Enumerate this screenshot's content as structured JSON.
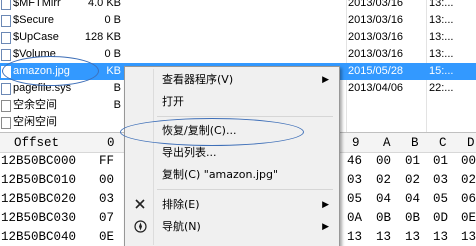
{
  "file_list": {
    "rows": [
      {
        "name": "$MFTMirr",
        "size": "4.0 KB",
        "date": "2013/03/16",
        "time": "13:...",
        "icon": "file-icon"
      },
      {
        "name": "$Secure",
        "size": "0 B",
        "date": "2013/03/16",
        "time": "13:...",
        "icon": "file-icon"
      },
      {
        "name": "$UpCase",
        "size": "128 KB",
        "date": "2013/03/16",
        "time": "13:...",
        "icon": "file-icon"
      },
      {
        "name": "$Volume",
        "size": "0 B",
        "date": "2013/03/16",
        "time": "13:...",
        "icon": "file-icon"
      },
      {
        "name": "amazon.jpg",
        "size": "KB",
        "date": "2015/05/28",
        "time": "15:...",
        "icon": "image-file-icon",
        "selected": true
      },
      {
        "name": "pagefile.sys",
        "size": "B",
        "date": "2013/04/06",
        "time": "22:...",
        "icon": "file-icon"
      },
      {
        "name": "空余空间",
        "size": "B",
        "date": "",
        "time": "",
        "icon": "system-file-icon"
      },
      {
        "name": "空闲空间",
        "size": "",
        "date": "",
        "time": "",
        "icon": "system-file-icon"
      }
    ]
  },
  "hex_view": {
    "header": {
      "offset": "Offset",
      "columns": [
        "0",
        "9",
        "A",
        "B",
        "C",
        "D"
      ]
    },
    "rows": [
      {
        "offset": "12B50BC000",
        "c0": "FF",
        "c9": "46",
        "cA": "00",
        "cB": "01",
        "cC": "01",
        "cD": "00"
      },
      {
        "offset": "12B50BC010",
        "c0": "00",
        "c9": "03",
        "cA": "02",
        "cB": "02",
        "cC": "03",
        "cD": "02"
      },
      {
        "offset": "12B50BC020",
        "c0": "03",
        "c9": "05",
        "cA": "04",
        "cB": "04",
        "cC": "05",
        "cD": "06"
      },
      {
        "offset": "12B50BC030",
        "c0": "07",
        "c9": "0A",
        "cA": "0B",
        "cB": "0B",
        "cC": "0D",
        "cD": "0E"
      },
      {
        "offset": "12B50BC040",
        "c0": "0E",
        "c9": "13",
        "cA": "13",
        "cB": "13",
        "cC": "13",
        "cD": "13"
      }
    ]
  },
  "context_menu": {
    "items": [
      {
        "label": "查看器程序(V)",
        "icon": "",
        "submenu": true
      },
      {
        "label": "打开",
        "icon": "open-icon",
        "submenu": false
      },
      {
        "label": "恢复/复制(C)...",
        "icon": "restore-icon",
        "submenu": false,
        "highlighted": true
      },
      {
        "label": "导出列表...",
        "icon": "export-list-icon",
        "submenu": false
      },
      {
        "label": "复制(C) \"amazon.jpg\"",
        "icon": "copy-icon",
        "submenu": false
      },
      {
        "label": "排除(E)",
        "icon": "exclude-icon",
        "submenu": true
      },
      {
        "label": "导航(N)",
        "icon": "navigate-icon",
        "submenu": true
      }
    ]
  },
  "colors": {
    "selection": "#3399ff",
    "annotation": "#3e6fb8",
    "menu_bg": "#f0f0f0"
  }
}
